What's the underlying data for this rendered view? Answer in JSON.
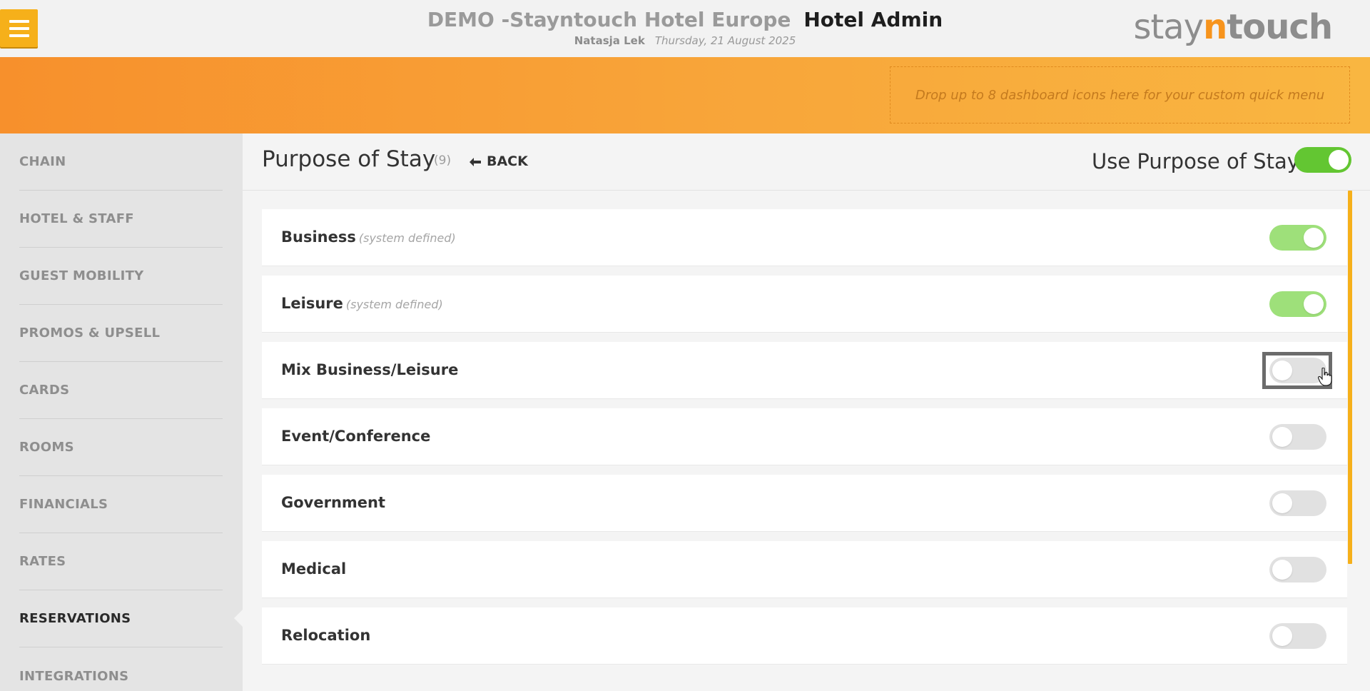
{
  "header": {
    "hotel_name": "DEMO -Stayntouch Hotel Europe",
    "section": "Hotel Admin",
    "user": "Natasja Lek",
    "date": "Thursday, 21 August 2025",
    "brand": {
      "part1": "stay",
      "part2": "n",
      "part3": "touch"
    },
    "menu_icon": "hamburger-icon"
  },
  "quick_menu": {
    "placeholder": "Drop up to 8 dashboard icons here for your custom quick menu"
  },
  "sidebar": {
    "items": [
      {
        "label": "CHAIN"
      },
      {
        "label": "HOTEL & STAFF"
      },
      {
        "label": "GUEST MOBILITY"
      },
      {
        "label": "PROMOS & UPSELL"
      },
      {
        "label": "CARDS"
      },
      {
        "label": "ROOMS"
      },
      {
        "label": "FINANCIALS"
      },
      {
        "label": "RATES"
      },
      {
        "label": "RESERVATIONS"
      },
      {
        "label": "INTEGRATIONS"
      }
    ],
    "active": "RESERVATIONS"
  },
  "page": {
    "title": "Purpose of Stay",
    "count": "(9)",
    "back_label": "BACK",
    "use_label": "Use Purpose of Stay",
    "use_enabled": true
  },
  "purposes": [
    {
      "name": "Business",
      "note": "(system defined)",
      "enabled": true
    },
    {
      "name": "Leisure",
      "note": "(system defined)",
      "enabled": true
    },
    {
      "name": "Mix Business/Leisure",
      "note": "",
      "enabled": false
    },
    {
      "name": "Event/Conference",
      "note": "",
      "enabled": false
    },
    {
      "name": "Government",
      "note": "",
      "enabled": false
    },
    {
      "name": "Medical",
      "note": "",
      "enabled": false
    },
    {
      "name": "Relocation",
      "note": "",
      "enabled": false
    }
  ],
  "colors": {
    "accent_orange": "#f7941d",
    "menu_button": "#f6b01a",
    "toggle_on": "#63c632",
    "toggle_on_locked": "#9ee07a",
    "toggle_off": "#e1e1e1"
  }
}
